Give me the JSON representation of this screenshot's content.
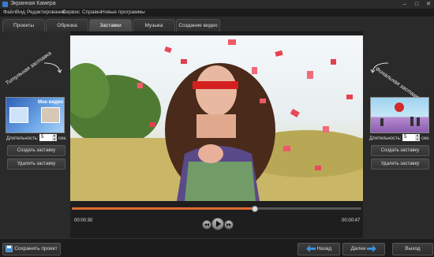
{
  "window": {
    "title": "Экранная Камера"
  },
  "menu": [
    "Файл",
    "Вид",
    "Редактирование",
    "Сервис",
    "Справка",
    "Новые программы"
  ],
  "tabs": [
    "Проекты",
    "Обрезка",
    "Заставки",
    "Музыка",
    "Создание видео"
  ],
  "left_panel": {
    "title": "Титульная заставка",
    "thumb_text": "Мое видео",
    "duration_label": "Длительность:",
    "duration_value": "5",
    "duration_unit": "сек.",
    "create_button": "Создать заставку",
    "delete_button": "Удалить заставку"
  },
  "right_panel": {
    "title": "Финальная заставка",
    "duration_label": "Длительность:",
    "duration_value": "5",
    "duration_unit": "сек.",
    "create_button": "Создать заставку",
    "delete_button": "Удалить заставку"
  },
  "player": {
    "current_time": "00:00:30",
    "total_time": "00:00:47",
    "progress": 0.63
  },
  "bottom": {
    "save_project": "Сохранить проект",
    "back": "Назад",
    "next": "Далее",
    "exit": "Выход"
  },
  "colors": {
    "accent": "#e06a2f",
    "arrow_blue": "#3a8fd8"
  }
}
